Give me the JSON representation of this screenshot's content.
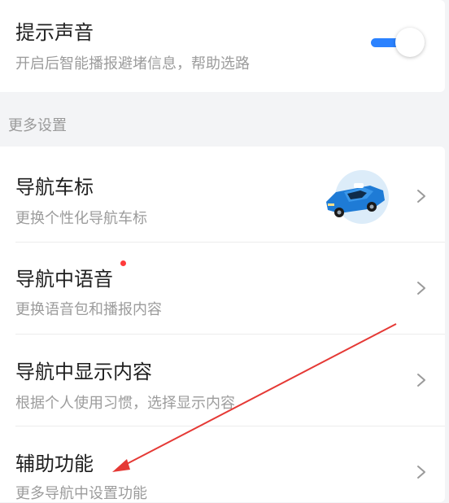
{
  "sound": {
    "title": "提示声音",
    "subtitle": "开启后智能播报避堵信息，帮助选路",
    "toggle_on": true
  },
  "section": {
    "label": "更多设置"
  },
  "items": [
    {
      "title": "导航车标",
      "subtitle": "更换个性化导航车标",
      "icon": "car-icon"
    },
    {
      "title": "导航中语音",
      "subtitle": "更换语音包和播报内容",
      "badge": "red-dot"
    },
    {
      "title": "导航中显示内容",
      "subtitle": "根据个人使用习惯，选择显示内容"
    },
    {
      "title": "辅助功能",
      "subtitle": "更多导航中设置功能"
    }
  ],
  "colors": {
    "accent": "#2b82ff",
    "annotation": "#e53935",
    "badge": "#ff3b3b"
  }
}
